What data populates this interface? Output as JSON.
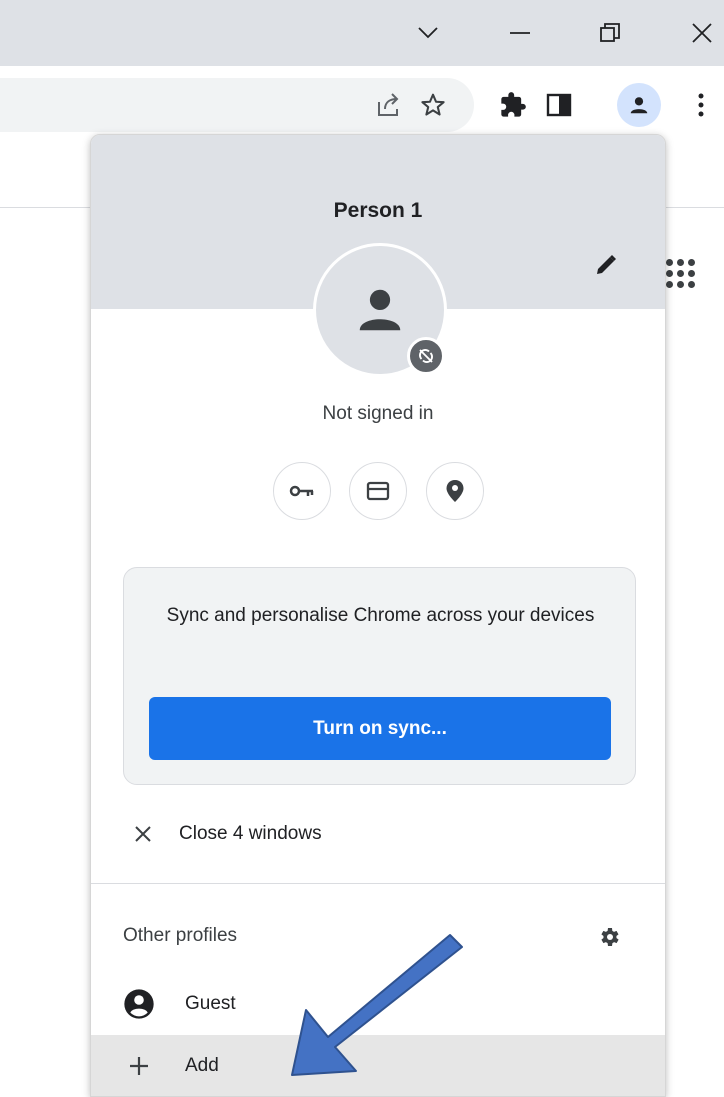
{
  "window": {
    "controls": [
      "chevron-down-icon",
      "minimize-icon",
      "restore-icon",
      "close-icon"
    ]
  },
  "toolbar": {
    "icons": [
      "share-icon",
      "bookmark-star-icon",
      "extensions-puzzle-icon",
      "side-panel-icon",
      "profile-avatar-icon",
      "more-vert-icon"
    ]
  },
  "profile_menu": {
    "name": "Person 1",
    "status": "Not signed in",
    "quick_actions": [
      "key-icon",
      "card-icon",
      "location-icon"
    ],
    "sync": {
      "description": "Sync and personalise Chrome across your devices",
      "button_label": "Turn on sync..."
    },
    "close_windows_label": "Close 4 windows",
    "other_profiles": {
      "heading": "Other profiles",
      "items": [
        {
          "label": "Guest",
          "icon": "guest-account-icon"
        },
        {
          "label": "Add",
          "icon": "plus-icon"
        }
      ]
    }
  },
  "colors": {
    "accent": "#1a73e8",
    "header_bg": "#dee1e6",
    "arrow": "#4472c4"
  }
}
